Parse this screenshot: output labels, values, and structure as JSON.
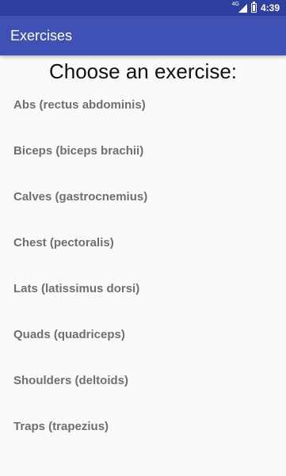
{
  "status_bar": {
    "network": "4G",
    "time": "4:39",
    "signal_icon": "cell-signal-icon",
    "battery_icon": "battery-icon"
  },
  "app_bar": {
    "title": "Exercises",
    "color": "#3f51b5"
  },
  "main": {
    "heading": "Choose an exercise:",
    "exercises": [
      "Abs (rectus abdominis)",
      "Biceps (biceps brachii)",
      "Calves (gastrocnemius)",
      "Chest (pectoralis)",
      "Lats (latissimus dorsi)",
      "Quads (quadriceps)",
      "Shoulders (deltoids)",
      "Traps (trapezius)"
    ]
  }
}
